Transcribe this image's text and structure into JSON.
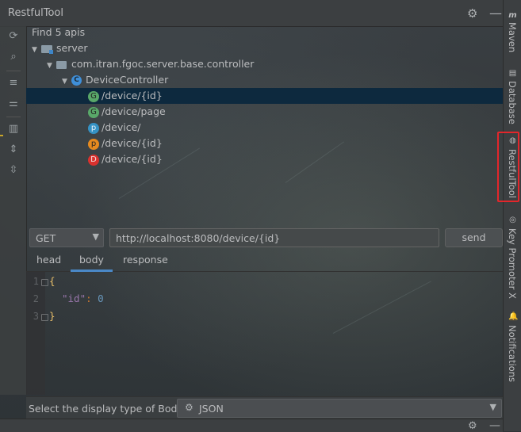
{
  "window": {
    "title": "RestfulTool"
  },
  "tree": {
    "summary": "Find 5 apis",
    "module": "server",
    "package": "com.itran.fgoc.server.base.controller",
    "controller": "DeviceController",
    "controller_badge": "C",
    "endpoints": [
      {
        "badge": "G",
        "path": "/device/{id}",
        "kind": "get",
        "selected": true
      },
      {
        "badge": "G",
        "path": "/device/page",
        "kind": "get",
        "selected": false
      },
      {
        "badge": "p",
        "path": "/device/",
        "kind": "post",
        "selected": false
      },
      {
        "badge": "p",
        "path": "/device/{id}",
        "kind": "put",
        "selected": false
      },
      {
        "badge": "D",
        "path": "/device/{id}",
        "kind": "delete",
        "selected": false
      }
    ]
  },
  "request": {
    "method": "GET",
    "url": "http://localhost:8080/device/{id}",
    "send_label": "send"
  },
  "tabs": [
    {
      "label": "head",
      "active": false
    },
    {
      "label": "body",
      "active": true
    },
    {
      "label": "response",
      "active": false
    }
  ],
  "editor": {
    "line_numbers": [
      "1",
      "2",
      "3"
    ],
    "line1": "{",
    "line2_key": "\"id\"",
    "line2_colon": ":",
    "line2_value": "0",
    "line3": "}"
  },
  "body_type": {
    "label": "Select the display type of Body:",
    "value": "JSON"
  },
  "right_tool_windows": [
    {
      "label": "Maven",
      "icon": "maven-icon"
    },
    {
      "label": "Database",
      "icon": "database-icon"
    },
    {
      "label": "RestfulTool",
      "icon": "globe-icon",
      "highlighted": true
    },
    {
      "label": "Key Promoter X",
      "icon": "key-promoter-icon"
    },
    {
      "label": "Notifications",
      "icon": "bell-icon"
    }
  ],
  "colors": {
    "selection": "#0d293e",
    "highlight_border": "#e3262b",
    "get_badge": "#59a869",
    "post_badge": "#3592c4",
    "put_badge": "#e68a1f",
    "delete_badge": "#d9312e"
  }
}
